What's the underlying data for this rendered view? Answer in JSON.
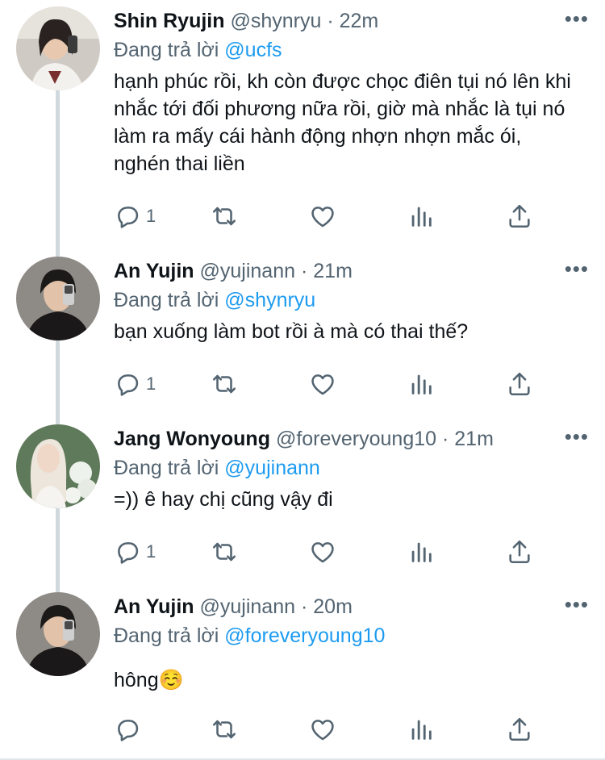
{
  "colors": {
    "link": "#1d9bf0",
    "muted": "#536471",
    "text": "#0f1419",
    "thread_line": "#cfd9de"
  },
  "tweets": [
    {
      "name": "Shin Ryujin",
      "handle": "@shynryu",
      "dot": "·",
      "time": "22m",
      "reply_prefix": "Đang trả lời",
      "reply_to": "@ucfs",
      "text": "hạnh phúc rồi, kh còn được chọc điên tụi nó lên khi nhắc tới đối phương nữa rồi, giờ mà nhắc là tụi nó làm ra mấy cái hành động nhợn nhợn mắc ói, nghén thai liền",
      "reply_count": "1",
      "more_icon": "more-icon"
    },
    {
      "name": "An Yujin",
      "handle": "@yujinann",
      "dot": "·",
      "time": "21m",
      "reply_prefix": "Đang trả lời",
      "reply_to": "@shynryu",
      "text": "bạn xuống làm bot rồi à mà có thai thế?",
      "reply_count": "1",
      "more_icon": "more-icon"
    },
    {
      "name": "Jang Wonyoung",
      "handle": "@foreveryoung10",
      "dot": "·",
      "time": "21m",
      "reply_prefix": "Đang trả lời",
      "reply_to": "@yujinann",
      "text": "=)) ê hay chị cũng vậy đi",
      "reply_count": "1",
      "more_icon": "more-icon"
    },
    {
      "name": "An Yujin",
      "handle": "@yujinann",
      "dot": "·",
      "time": "20m",
      "reply_prefix": "Đang trả lời",
      "reply_to": "@foreveryoung10",
      "text": "hông☺️",
      "reply_count": "",
      "more_icon": "more-icon"
    }
  ],
  "more_glyph": "•••"
}
